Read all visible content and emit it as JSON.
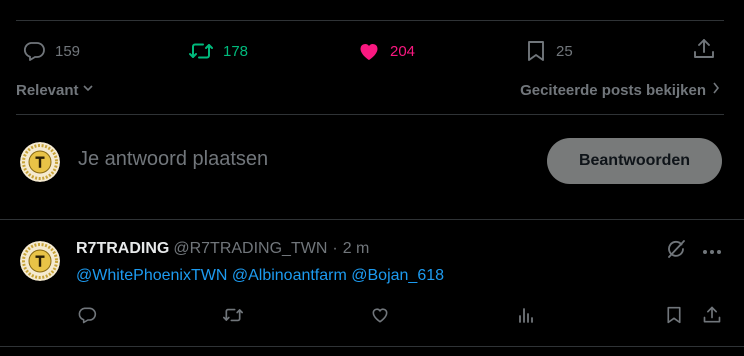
{
  "post_stats": {
    "replies": "159",
    "reposts": "178",
    "likes": "204",
    "bookmarks": "25"
  },
  "sort": {
    "label": "Relevant"
  },
  "quotes_link": {
    "label": "Geciteerde posts bekijken"
  },
  "compose": {
    "placeholder": "Je antwoord plaatsen",
    "reply_button": "Beantwoorden"
  },
  "reply": {
    "name": "R7TRADING",
    "handle": "@R7TRADING_TWN",
    "separator": "·",
    "time": "2 m",
    "mentions": [
      "@WhitePhoenixTWN",
      "@Albinoantfarm",
      "@Bojan_618"
    ]
  },
  "colors": {
    "background": "#000000",
    "muted": "#71767b",
    "repost_active": "#00ba7c",
    "like_active": "#f91880",
    "link": "#1d9bf0",
    "divider": "#2f3336",
    "button_disabled": "#787a7a"
  },
  "icons": {
    "reply": "reply-icon",
    "repost": "repost-icon",
    "like": "heart-icon",
    "bookmark": "bookmark-icon",
    "share": "share-icon",
    "chevron_down": "chevron-down-icon",
    "chevron_right": "chevron-right-icon",
    "grok": "grok-icon",
    "more": "more-icon",
    "views": "views-icon"
  }
}
